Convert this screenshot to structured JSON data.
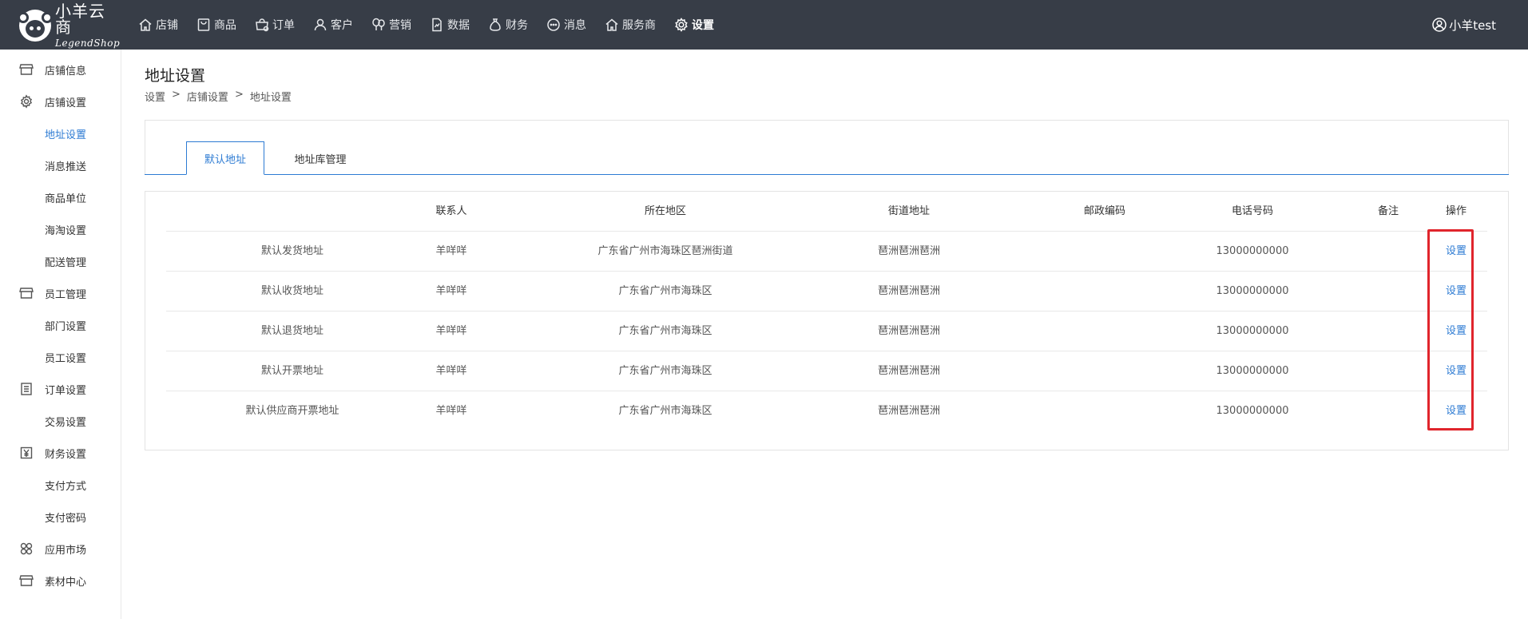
{
  "brand": {
    "name_cn": "小羊云商",
    "name_en": "LegendShop"
  },
  "nav": [
    {
      "label": "店铺",
      "icon": "home-icon"
    },
    {
      "label": "商品",
      "icon": "bag-icon"
    },
    {
      "label": "订单",
      "icon": "cart-icon"
    },
    {
      "label": "客户",
      "icon": "user-icon"
    },
    {
      "label": "营销",
      "icon": "balloon-icon"
    },
    {
      "label": "数据",
      "icon": "document-icon"
    },
    {
      "label": "财务",
      "icon": "moneybag-icon"
    },
    {
      "label": "消息",
      "icon": "chat-icon"
    },
    {
      "label": "服务商",
      "icon": "home-icon"
    },
    {
      "label": "设置",
      "icon": "gear-icon",
      "active": true
    }
  ],
  "user": {
    "name": "小羊test"
  },
  "sidebar": [
    {
      "label": "店铺信息",
      "icon": "store-icon"
    },
    {
      "label": "店铺设置",
      "icon": "gear-icon"
    },
    {
      "label": "地址设置",
      "active": true
    },
    {
      "label": "消息推送"
    },
    {
      "label": "商品单位"
    },
    {
      "label": "海淘设置"
    },
    {
      "label": "配送管理"
    },
    {
      "label": "员工管理",
      "icon": "store-icon"
    },
    {
      "label": "部门设置"
    },
    {
      "label": "员工设置"
    },
    {
      "label": "订单设置",
      "icon": "list-icon"
    },
    {
      "label": "交易设置"
    },
    {
      "label": "财务设置",
      "icon": "yen-icon"
    },
    {
      "label": "支付方式"
    },
    {
      "label": "支付密码"
    },
    {
      "label": "应用市场",
      "icon": "apps-icon"
    },
    {
      "label": "素材中心",
      "icon": "store-icon"
    }
  ],
  "page": {
    "title": "地址设置",
    "breadcrumb": [
      "设置",
      "店铺设置",
      "地址设置"
    ],
    "tabs": [
      {
        "label": "默认地址",
        "active": true
      },
      {
        "label": "地址库管理"
      }
    ]
  },
  "table": {
    "headers": [
      "",
      "联系人",
      "所在地区",
      "街道地址",
      "邮政编码",
      "电话号码",
      "备注",
      "操作"
    ],
    "rows": [
      {
        "type": "默认发货地址",
        "contact": "羊咩咩",
        "region": "广东省广州市海珠区琶洲街道",
        "street": "琶洲琶洲琶洲",
        "zip": "",
        "phone": "13000000000",
        "note": "",
        "action": "设置"
      },
      {
        "type": "默认收货地址",
        "contact": "羊咩咩",
        "region": "广东省广州市海珠区",
        "street": "琶洲琶洲琶洲",
        "zip": "",
        "phone": "13000000000",
        "note": "",
        "action": "设置"
      },
      {
        "type": "默认退货地址",
        "contact": "羊咩咩",
        "region": "广东省广州市海珠区",
        "street": "琶洲琶洲琶洲",
        "zip": "",
        "phone": "13000000000",
        "note": "",
        "action": "设置"
      },
      {
        "type": "默认开票地址",
        "contact": "羊咩咩",
        "region": "广东省广州市海珠区",
        "street": "琶洲琶洲琶洲",
        "zip": "",
        "phone": "13000000000",
        "note": "",
        "action": "设置"
      },
      {
        "type": "默认供应商开票地址",
        "contact": "羊咩咩",
        "region": "广东省广州市海珠区",
        "street": "琶洲琶洲琶洲",
        "zip": "",
        "phone": "13000000000",
        "note": "",
        "action": "设置"
      }
    ]
  },
  "colors": {
    "topbar": "#373d47",
    "accent": "#2d7bd3",
    "highlight": "#e0252c"
  }
}
